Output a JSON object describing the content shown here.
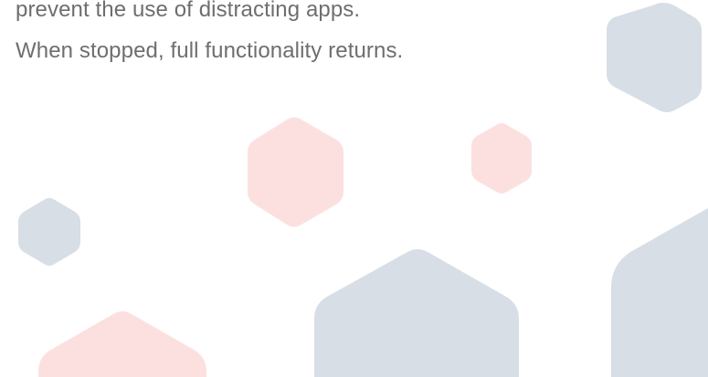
{
  "description": {
    "lines": [
      "prevent the use of distracting apps.",
      "When stopped, full functionality returns."
    ]
  },
  "colors": {
    "background": "#ffffff",
    "text": "#6e6e6e",
    "hexagon_blue": "#d7dee5",
    "hexagon_pink": "#fce0e0"
  }
}
